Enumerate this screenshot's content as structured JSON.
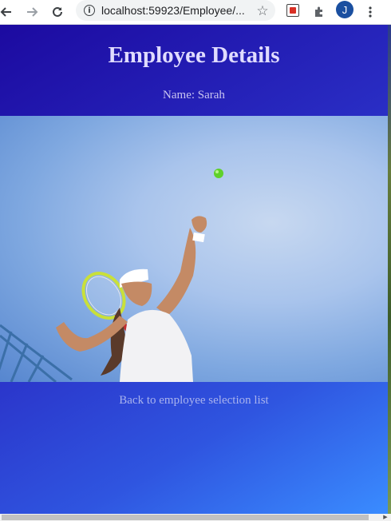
{
  "browser": {
    "url": "localhost:59923/Employee/...",
    "avatar_initial": "J",
    "icons": [
      "back-arrow-icon",
      "forward-arrow-icon",
      "reload-icon",
      "info-icon",
      "star-icon",
      "extension-icon",
      "puzzle-icon",
      "menu-dots-icon"
    ]
  },
  "page": {
    "title": "Employee Details",
    "name_line": "Name: Sarah",
    "back_link": "Back to employee selection list",
    "photo_subject": "tennis player serving"
  },
  "colors": {
    "background_start": "#1c0aa0",
    "background_end": "#3a8cff",
    "heading": "#e0dcff",
    "link": "#a9b3ee"
  }
}
